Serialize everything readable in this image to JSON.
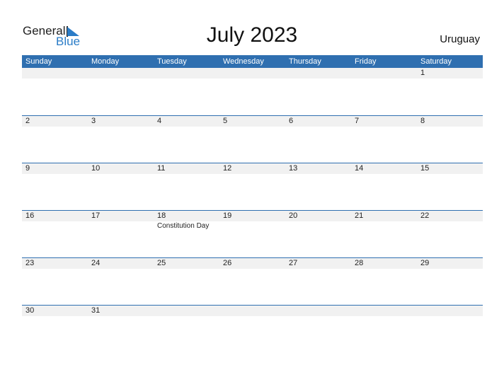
{
  "logo": {
    "general": "General",
    "blue": "Blue"
  },
  "title": "July 2023",
  "country": "Uruguay",
  "colors": {
    "header": "#2f6fb0",
    "accent": "#2a7cc7",
    "date_strip": "#f1f1f1"
  },
  "weekdays": [
    "Sunday",
    "Monday",
    "Tuesday",
    "Wednesday",
    "Thursday",
    "Friday",
    "Saturday"
  ],
  "weeks": [
    {
      "days": [
        "",
        "",
        "",
        "",
        "",
        "",
        "1"
      ],
      "events": [
        "",
        "",
        "",
        "",
        "",
        "",
        ""
      ]
    },
    {
      "days": [
        "2",
        "3",
        "4",
        "5",
        "6",
        "7",
        "8"
      ],
      "events": [
        "",
        "",
        "",
        "",
        "",
        "",
        ""
      ]
    },
    {
      "days": [
        "9",
        "10",
        "11",
        "12",
        "13",
        "14",
        "15"
      ],
      "events": [
        "",
        "",
        "",
        "",
        "",
        "",
        ""
      ]
    },
    {
      "days": [
        "16",
        "17",
        "18",
        "19",
        "20",
        "21",
        "22"
      ],
      "events": [
        "",
        "",
        "Constitution Day",
        "",
        "",
        "",
        ""
      ]
    },
    {
      "days": [
        "23",
        "24",
        "25",
        "26",
        "27",
        "28",
        "29"
      ],
      "events": [
        "",
        "",
        "",
        "",
        "",
        "",
        ""
      ]
    },
    {
      "days": [
        "30",
        "31",
        "",
        "",
        "",
        "",
        ""
      ],
      "events": [
        "",
        "",
        "",
        "",
        "",
        "",
        ""
      ]
    }
  ]
}
